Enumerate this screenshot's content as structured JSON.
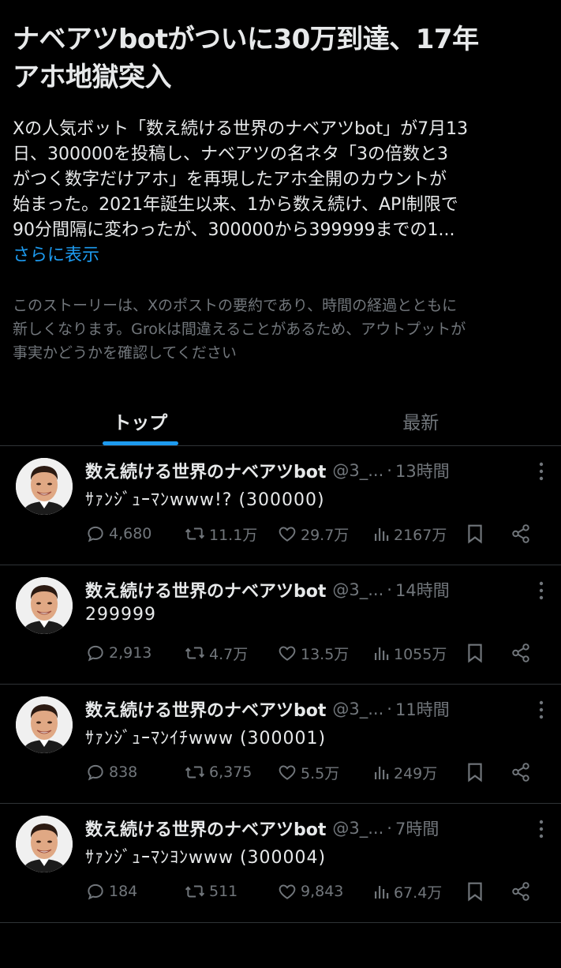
{
  "story": {
    "title_lines": [
      "ナベアツbotがついに30万到達、17年",
      "アホ地獄突入"
    ],
    "summary_lines": [
      "Xの人気ボット「数え続ける世界のナベアツbot」が7月13",
      "日、300000を投稿し、ナベアツの名ネタ「3の倍数と3",
      "がつく数字だけアホ」を再現したアホ全開のカウントが",
      "始まった。2021年誕生以来、1から数え続け、API制限で",
      "90分間隔に変わったが、300000から399999までの1..."
    ],
    "show_more": "さらに表示",
    "disclaimer_lines": [
      "このストーリーは、Xのポストの要約であり、時間の経過とともに",
      "新しくなります。Grokは間違えることがあるため、アウトプットが",
      "事実かどうかを確認してください"
    ]
  },
  "tabs": [
    {
      "label": "トップ",
      "active": true
    },
    {
      "label": "最新",
      "active": false
    }
  ],
  "tweets": [
    {
      "author": "数え続ける世界のナベアツbot",
      "handle": "@3_...",
      "time": "13時間",
      "text": "ｻｧﾝｼﾞｭｰﾏﾝwww!? (300000)",
      "replies": "4,680",
      "retweets": "11.1万",
      "likes": "29.7万",
      "views": "2167万"
    },
    {
      "author": "数え続ける世界のナベアツbot",
      "handle": "@3_...",
      "time": "14時間",
      "text": "299999",
      "replies": "2,913",
      "retweets": "4.7万",
      "likes": "13.5万",
      "views": "1055万"
    },
    {
      "author": "数え続ける世界のナベアツbot",
      "handle": "@3_...",
      "time": "11時間",
      "text": "ｻｧﾝｼﾞｭｰﾏﾝｲﾁwww (300001)",
      "replies": "838",
      "retweets": "6,375",
      "likes": "5.5万",
      "views": "249万"
    },
    {
      "author": "数え続ける世界のナベアツbot",
      "handle": "@3_...",
      "time": "7時間",
      "text": "ｻｧﾝｼﾞｭｰﾏﾝﾖﾝwww (300004)",
      "replies": "184",
      "retweets": "511",
      "likes": "9,843",
      "views": "67.4万"
    }
  ],
  "colors": {
    "accent": "#1d9bf0",
    "muted": "#71767b",
    "text": "#e7e9ea",
    "background": "#000000"
  },
  "icons": [
    "reply-icon",
    "retweet-icon",
    "like-icon",
    "views-icon",
    "bookmark-icon",
    "share-icon",
    "more-icon"
  ]
}
